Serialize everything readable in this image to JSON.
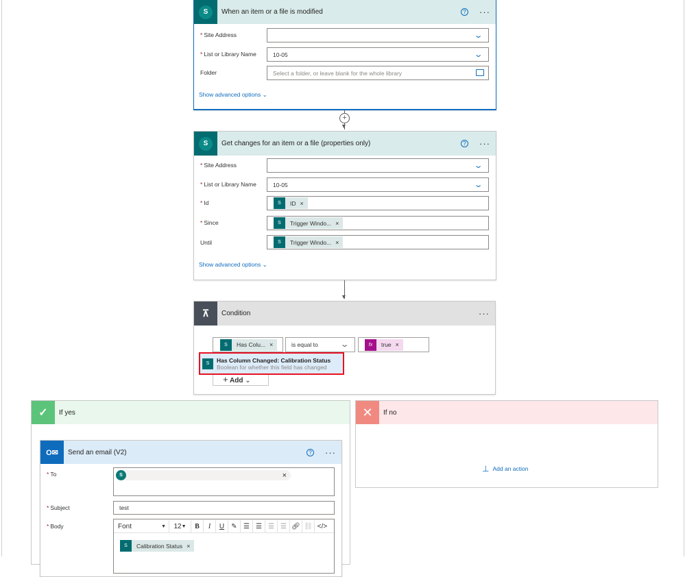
{
  "trigger": {
    "title": "When an item or a file is modified",
    "fields": [
      {
        "label": "Site Address",
        "required": true,
        "value": ""
      },
      {
        "label": "List or Library Name",
        "required": true,
        "value": "10-05"
      },
      {
        "label": "Folder",
        "required": false,
        "placeholder": "Select a folder, or leave blank for the whole library"
      }
    ],
    "advanced": "Show advanced options"
  },
  "get_changes": {
    "title": "Get changes for an item or a file (properties only)",
    "fields": [
      {
        "label": "Site Address",
        "required": true,
        "value": ""
      },
      {
        "label": "List or Library Name",
        "required": true,
        "value": "10-05"
      },
      {
        "label": "Id",
        "required": true,
        "token": "ID"
      },
      {
        "label": "Since",
        "required": true,
        "token": "Trigger Windo..."
      },
      {
        "label": "Until",
        "required": false,
        "token": "Trigger Windo..."
      }
    ],
    "advanced": "Show advanced options"
  },
  "condition": {
    "title": "Condition",
    "left_token": "Has Colu...",
    "operator": "is equal to",
    "right_token": "true",
    "tooltip_title": "Has Column Changed: Calibration Status",
    "tooltip_desc": "Boolean for whether this field has changed",
    "add_label": "Add",
    "highlight_color": "#e81123"
  },
  "if_yes": {
    "title": "If yes"
  },
  "if_no": {
    "title": "If no",
    "add_action": "Add an action"
  },
  "email": {
    "title": "Send an email (V2)",
    "to_label": "To",
    "to_avatar": "S",
    "subject_label": "Subject",
    "subject_value": "test",
    "body_label": "Body",
    "font": "Font",
    "font_size": "12",
    "body_token": "Calibration Status"
  },
  "colors": {
    "sharepoint": "#036c70",
    "outlook": "#0f6cbd",
    "condition": "#484f58",
    "yes": "#5bc47a",
    "no": "#f08a80"
  }
}
